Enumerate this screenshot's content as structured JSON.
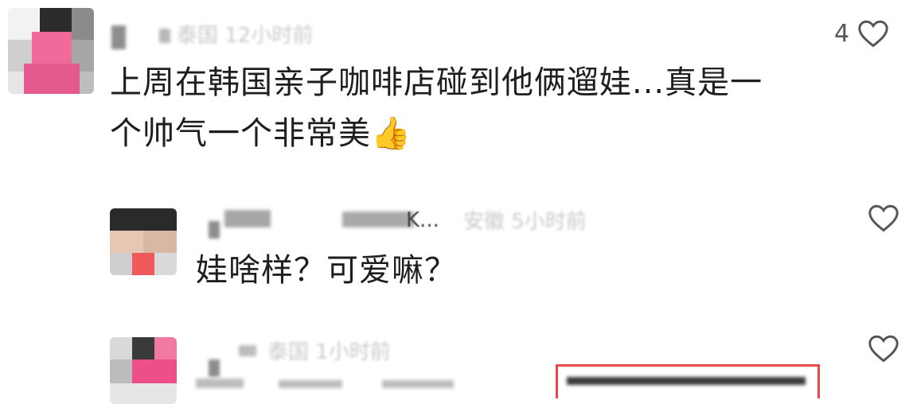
{
  "comments": [
    {
      "meta": "泰国 12小时前",
      "text_line1": "上周在韩国亲子咖啡店碰到他俩遛娃...真是一",
      "text_line2": "个帅气一个非常美",
      "emoji": "👍",
      "likes": "4"
    },
    {
      "meta": "安徽 5小时前",
      "name_tail": "K...",
      "text_line1": "娃啥样？可爱嘛？"
    },
    {
      "meta": "泰国 1小时前"
    }
  ],
  "icons": {
    "like": "heart-outline-icon",
    "thumbs": "thumbs-up-icon"
  }
}
